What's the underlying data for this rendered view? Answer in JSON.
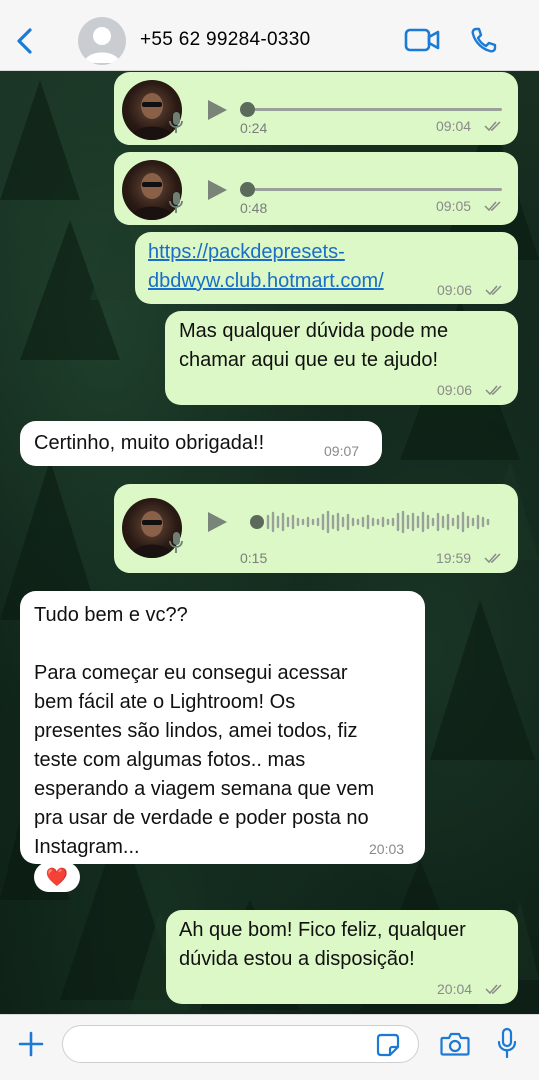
{
  "header": {
    "contact": "+55 62 99284-0330"
  },
  "messages": {
    "voice1": {
      "duration": "0:24",
      "time": "09:04"
    },
    "voice2": {
      "duration": "0:48",
      "time": "09:05"
    },
    "link": {
      "line1": "https://packdepresets-",
      "line2": "dbdwyw.club.hotmart.com/",
      "time": "09:06"
    },
    "out1": {
      "line1": "Mas qualquer dúvida pode me",
      "line2": "chamar aqui que eu te ajudo!",
      "time": "09:06"
    },
    "in1": {
      "text": "Certinho, muito obrigada!!",
      "time": "09:07"
    },
    "voice3": {
      "duration": "0:15",
      "time": "19:59"
    },
    "in2": {
      "line1": "Tudo bem e vc??",
      "line2": "Para começar eu consegui acessar",
      "line3": "bem fácil ate o Lightroom! Os",
      "line4": "presentes são lindos, amei todos, fiz",
      "line5": "teste com algumas fotos.. mas",
      "line6": "esperando a viagem semana que vem",
      "line7": "pra usar de verdade e poder posta no",
      "line8": "Instagram...",
      "time": "20:03",
      "reaction": "❤️"
    },
    "out2": {
      "line1": "Ah que bom! Fico feliz, qualquer",
      "line2": "dúvida estou a disposição!",
      "time": "20:04"
    }
  },
  "colors": {
    "outgoing_bubble": "#dcf8c6",
    "incoming_bubble": "#ffffff",
    "accent": "#1a6ec9"
  },
  "icons": [
    "back-icon",
    "video-icon",
    "phone-icon",
    "play-icon",
    "mic-icon",
    "double-check-icon",
    "plus-icon",
    "sticker-icon",
    "camera-icon"
  ]
}
